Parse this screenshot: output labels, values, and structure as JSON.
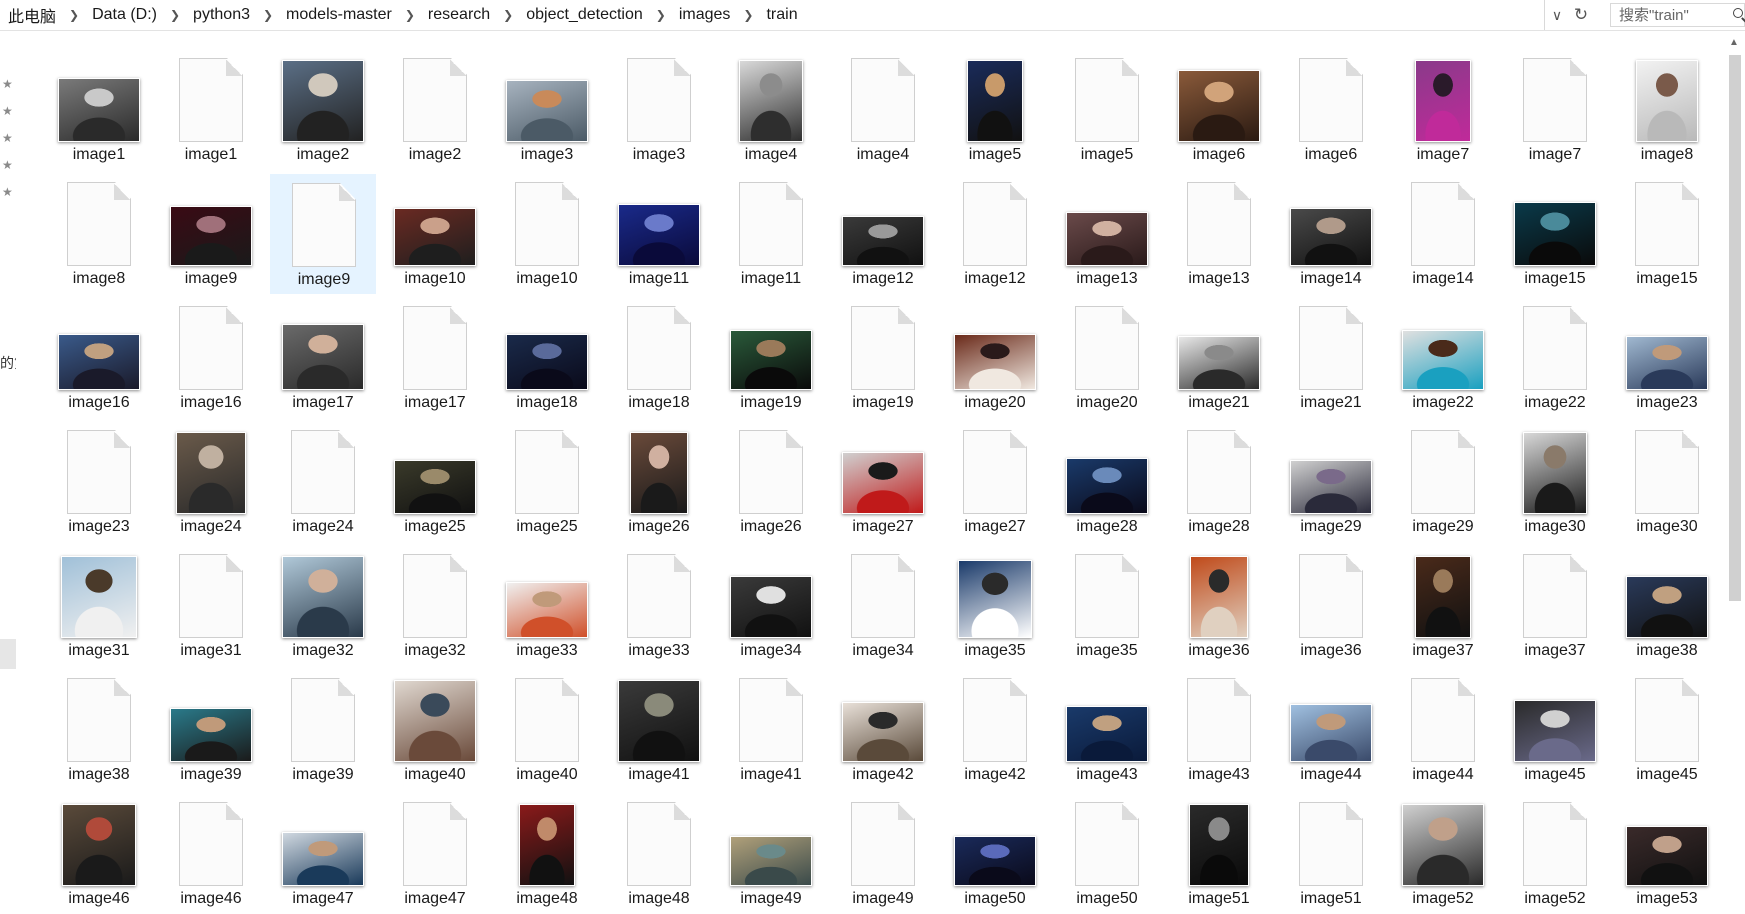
{
  "breadcrumb": [
    "此电脑",
    "Data (D:)",
    "python3",
    "models-master",
    "research",
    "object_detection",
    "images",
    "train"
  ],
  "search": {
    "placeholder": "搜索\"train\""
  },
  "nav": {
    "clipped_text": "的第"
  },
  "selected_file_index": 17,
  "colors": {
    "selection": "#e5f3ff",
    "border": "#d9d9d9"
  },
  "files": [
    {
      "name": "image1",
      "type": "photo",
      "w": 80,
      "h": 62,
      "c": [
        "#7a7a7a",
        "#2a2a2a",
        "#c9c9c9"
      ]
    },
    {
      "name": "image1",
      "type": "xml"
    },
    {
      "name": "image2",
      "type": "photo",
      "w": 80,
      "h": 80,
      "c": [
        "#5b6f86",
        "#222222",
        "#d0c8bc"
      ]
    },
    {
      "name": "image2",
      "type": "xml"
    },
    {
      "name": "image3",
      "type": "photo",
      "w": 80,
      "h": 60,
      "c": [
        "#a7b3bf",
        "#4b5a66",
        "#c98a5a"
      ]
    },
    {
      "name": "image3",
      "type": "xml"
    },
    {
      "name": "image4",
      "type": "photo",
      "w": 62,
      "h": 80,
      "c": [
        "#d9d9d9",
        "#2e2e2e",
        "#8c8c8c"
      ]
    },
    {
      "name": "image4",
      "type": "xml"
    },
    {
      "name": "image5",
      "type": "photo",
      "w": 54,
      "h": 80,
      "c": [
        "#1a2b5a",
        "#111111",
        "#c89a6a"
      ]
    },
    {
      "name": "image5",
      "type": "xml"
    },
    {
      "name": "image6",
      "type": "photo",
      "w": 80,
      "h": 70,
      "c": [
        "#8a5a3a",
        "#2a1a12",
        "#d1a37a"
      ]
    },
    {
      "name": "image6",
      "type": "xml"
    },
    {
      "name": "image7",
      "type": "photo",
      "w": 54,
      "h": 80,
      "c": [
        "#8a3a8a",
        "#c02a9a",
        "#2a1a2a"
      ]
    },
    {
      "name": "image7",
      "type": "xml"
    },
    {
      "name": "image8",
      "type": "photo",
      "w": 60,
      "h": 80,
      "c": [
        "#f2f2f2",
        "#b9b9b9",
        "#7a5a4a"
      ]
    },
    {
      "name": "image8",
      "type": "xml"
    },
    {
      "name": "image9",
      "type": "photo",
      "w": 80,
      "h": 58,
      "c": [
        "#3a0a14",
        "#1a1a1a",
        "#a0707a"
      ]
    },
    {
      "name": "image9",
      "type": "xml"
    },
    {
      "name": "image10",
      "type": "photo",
      "w": 80,
      "h": 56,
      "c": [
        "#6a2a22",
        "#1e1e1e",
        "#caa08a"
      ]
    },
    {
      "name": "image10",
      "type": "xml"
    },
    {
      "name": "image11",
      "type": "photo",
      "w": 80,
      "h": 60,
      "c": [
        "#1a2a8a",
        "#0a0a3a",
        "#6a7aca"
      ]
    },
    {
      "name": "image11",
      "type": "xml"
    },
    {
      "name": "image12",
      "type": "photo",
      "w": 80,
      "h": 48,
      "c": [
        "#3a3a3a",
        "#111111",
        "#9a9a9a"
      ]
    },
    {
      "name": "image12",
      "type": "xml"
    },
    {
      "name": "image13",
      "type": "photo",
      "w": 80,
      "h": 52,
      "c": [
        "#6a4a4a",
        "#2a1a1a",
        "#d0b0a0"
      ]
    },
    {
      "name": "image13",
      "type": "xml"
    },
    {
      "name": "image14",
      "type": "photo",
      "w": 80,
      "h": 56,
      "c": [
        "#4a4a4a",
        "#111111",
        "#b09a8a"
      ]
    },
    {
      "name": "image14",
      "type": "xml"
    },
    {
      "name": "image15",
      "type": "photo",
      "w": 80,
      "h": 62,
      "c": [
        "#0a3a4a",
        "#0a0a0a",
        "#4a8a9a"
      ]
    },
    {
      "name": "image15",
      "type": "xml"
    },
    {
      "name": "image16",
      "type": "photo",
      "w": 80,
      "h": 54,
      "c": [
        "#3a5a8a",
        "#1a1a2a",
        "#c0a080"
      ]
    },
    {
      "name": "image16",
      "type": "xml"
    },
    {
      "name": "image17",
      "type": "photo",
      "w": 80,
      "h": 64,
      "c": [
        "#6a6a6a",
        "#2a2a2a",
        "#d0b09a"
      ]
    },
    {
      "name": "image17",
      "type": "xml"
    },
    {
      "name": "image18",
      "type": "photo",
      "w": 80,
      "h": 54,
      "c": [
        "#1a2a4a",
        "#0a0a1a",
        "#5a6a9a"
      ]
    },
    {
      "name": "image18",
      "type": "xml"
    },
    {
      "name": "image19",
      "type": "photo",
      "w": 80,
      "h": 58,
      "c": [
        "#2a5a3a",
        "#0a0a0a",
        "#9a7a5a"
      ]
    },
    {
      "name": "image19",
      "type": "xml"
    },
    {
      "name": "image20",
      "type": "photo",
      "w": 80,
      "h": 54,
      "c": [
        "#6a2a1a",
        "#f0e8e0",
        "#2a1a1a"
      ]
    },
    {
      "name": "image20",
      "type": "xml"
    },
    {
      "name": "image21",
      "type": "photo",
      "w": 80,
      "h": 52,
      "c": [
        "#e8e8e8",
        "#2a2a2a",
        "#8a8a8a"
      ]
    },
    {
      "name": "image21",
      "type": "xml"
    },
    {
      "name": "image22",
      "type": "photo",
      "w": 80,
      "h": 58,
      "c": [
        "#e0e0e0",
        "#1aa0c0",
        "#4a2a1a"
      ]
    },
    {
      "name": "image22",
      "type": "xml"
    },
    {
      "name": "image23",
      "type": "photo",
      "w": 80,
      "h": 52,
      "c": [
        "#a0b8d0",
        "#2a3a5a",
        "#c09a7a"
      ]
    },
    {
      "name": "image23",
      "type": "xml"
    },
    {
      "name": "image24",
      "type": "photo",
      "w": 68,
      "h": 80,
      "c": [
        "#6a5a4a",
        "#2a2a2a",
        "#c0b0a0"
      ]
    },
    {
      "name": "image24",
      "type": "xml"
    },
    {
      "name": "image25",
      "type": "photo",
      "w": 80,
      "h": 52,
      "c": [
        "#3a3a2a",
        "#111111",
        "#9a8a6a"
      ]
    },
    {
      "name": "image25",
      "type": "xml"
    },
    {
      "name": "image26",
      "type": "photo",
      "w": 56,
      "h": 80,
      "c": [
        "#6a4a3a",
        "#1a1a1a",
        "#d0b0a0"
      ]
    },
    {
      "name": "image26",
      "type": "xml"
    },
    {
      "name": "image27",
      "type": "photo",
      "w": 80,
      "h": 60,
      "c": [
        "#d0d0d0",
        "#c01a1a",
        "#1a1a1a"
      ]
    },
    {
      "name": "image27",
      "type": "xml"
    },
    {
      "name": "image28",
      "type": "photo",
      "w": 80,
      "h": 54,
      "c": [
        "#1a3a6a",
        "#0a0a1a",
        "#6a8aba"
      ]
    },
    {
      "name": "image28",
      "type": "xml"
    },
    {
      "name": "image29",
      "type": "photo",
      "w": 80,
      "h": 52,
      "c": [
        "#d0d0d0",
        "#2a2a3a",
        "#7a6a8a"
      ]
    },
    {
      "name": "image29",
      "type": "xml"
    },
    {
      "name": "image30",
      "type": "photo",
      "w": 62,
      "h": 80,
      "c": [
        "#d8d8d8",
        "#1a1a1a",
        "#8a7a6a"
      ]
    },
    {
      "name": "image30",
      "type": "xml"
    },
    {
      "name": "image31",
      "type": "photo",
      "w": 74,
      "h": 80,
      "c": [
        "#a0c0d8",
        "#f0f0f0",
        "#4a3a2a"
      ]
    },
    {
      "name": "image31",
      "type": "xml"
    },
    {
      "name": "image32",
      "type": "photo",
      "w": 80,
      "h": 80,
      "c": [
        "#b0c8d8",
        "#2a3a4a",
        "#d0b09a"
      ]
    },
    {
      "name": "image32",
      "type": "xml"
    },
    {
      "name": "image33",
      "type": "photo",
      "w": 80,
      "h": 54,
      "c": [
        "#f0f0f0",
        "#d0502a",
        "#c09a7a"
      ]
    },
    {
      "name": "image33",
      "type": "xml"
    },
    {
      "name": "image34",
      "type": "photo",
      "w": 80,
      "h": 60,
      "c": [
        "#3a3a3a",
        "#111111",
        "#e0e0e0"
      ]
    },
    {
      "name": "image34",
      "type": "xml"
    },
    {
      "name": "image35",
      "type": "photo",
      "w": 72,
      "h": 76,
      "c": [
        "#1a3a6a",
        "#ffffff",
        "#2a2a2a"
      ]
    },
    {
      "name": "image35",
      "type": "xml"
    },
    {
      "name": "image36",
      "type": "photo",
      "w": 56,
      "h": 80,
      "c": [
        "#c04a1a",
        "#e0d0c0",
        "#2a2a2a"
      ]
    },
    {
      "name": "image36",
      "type": "xml"
    },
    {
      "name": "image37",
      "type": "photo",
      "w": 54,
      "h": 80,
      "c": [
        "#4a2a1a",
        "#111111",
        "#9a7a5a"
      ]
    },
    {
      "name": "image37",
      "type": "xml"
    },
    {
      "name": "image38",
      "type": "photo",
      "w": 80,
      "h": 60,
      "c": [
        "#2a3a5a",
        "#111111",
        "#c0a080"
      ]
    },
    {
      "name": "image38",
      "type": "xml"
    },
    {
      "name": "image39",
      "type": "photo",
      "w": 80,
      "h": 52,
      "c": [
        "#2a7a8a",
        "#1a1a1a",
        "#c09a7a"
      ]
    },
    {
      "name": "image39",
      "type": "xml"
    },
    {
      "name": "image40",
      "type": "photo",
      "w": 80,
      "h": 80,
      "c": [
        "#e0d8d0",
        "#6a4a3a",
        "#3a4a5a"
      ]
    },
    {
      "name": "image40",
      "type": "xml"
    },
    {
      "name": "image41",
      "type": "photo",
      "w": 80,
      "h": 80,
      "c": [
        "#3a3a3a",
        "#111111",
        "#8a8a7a"
      ]
    },
    {
      "name": "image41",
      "type": "xml"
    },
    {
      "name": "image42",
      "type": "photo",
      "w": 80,
      "h": 58,
      "c": [
        "#e8e0d8",
        "#5a4a3a",
        "#2a2a2a"
      ]
    },
    {
      "name": "image42",
      "type": "xml"
    },
    {
      "name": "image43",
      "type": "photo",
      "w": 80,
      "h": 54,
      "c": [
        "#1a3a6a",
        "#0a1a3a",
        "#c0a080"
      ]
    },
    {
      "name": "image43",
      "type": "xml"
    },
    {
      "name": "image44",
      "type": "photo",
      "w": 80,
      "h": 56,
      "c": [
        "#a0c0e0",
        "#3a4a6a",
        "#c09a7a"
      ]
    },
    {
      "name": "image44",
      "type": "xml"
    },
    {
      "name": "image45",
      "type": "photo",
      "w": 80,
      "h": 60,
      "c": [
        "#2a2a2a",
        "#6a6a8a",
        "#d0d0d0"
      ]
    },
    {
      "name": "image45",
      "type": "xml"
    },
    {
      "name": "image46",
      "type": "photo",
      "w": 72,
      "h": 80,
      "c": [
        "#5a4a3a",
        "#1a1a1a",
        "#b04a3a"
      ]
    },
    {
      "name": "image46",
      "type": "xml"
    },
    {
      "name": "image47",
      "type": "photo",
      "w": 80,
      "h": 52,
      "c": [
        "#d0d8e0",
        "#1a3a5a",
        "#c09a7a"
      ]
    },
    {
      "name": "image47",
      "type": "xml"
    },
    {
      "name": "image48",
      "type": "photo",
      "w": 54,
      "h": 80,
      "c": [
        "#8a1a1a",
        "#111111",
        "#c08a6a"
      ]
    },
    {
      "name": "image48",
      "type": "xml"
    },
    {
      "name": "image49",
      "type": "photo",
      "w": 80,
      "h": 48,
      "c": [
        "#b0a07a",
        "#3a4a4a",
        "#6a8a8a"
      ]
    },
    {
      "name": "image49",
      "type": "xml"
    },
    {
      "name": "image50",
      "type": "photo",
      "w": 80,
      "h": 48,
      "c": [
        "#1a2a5a",
        "#0a0a1a",
        "#5a6aba"
      ]
    },
    {
      "name": "image50",
      "type": "xml"
    },
    {
      "name": "image51",
      "type": "photo",
      "w": 58,
      "h": 80,
      "c": [
        "#2a2a2a",
        "#0a0a0a",
        "#8a8a8a"
      ]
    },
    {
      "name": "image51",
      "type": "xml"
    },
    {
      "name": "image52",
      "type": "photo",
      "w": 80,
      "h": 80,
      "c": [
        "#d0d0d0",
        "#2a2a2a",
        "#c0a08a"
      ]
    },
    {
      "name": "image52",
      "type": "xml"
    },
    {
      "name": "image53",
      "type": "photo",
      "w": 80,
      "h": 58,
      "c": [
        "#3a2a2a",
        "#111111",
        "#c0a08a"
      ]
    }
  ]
}
